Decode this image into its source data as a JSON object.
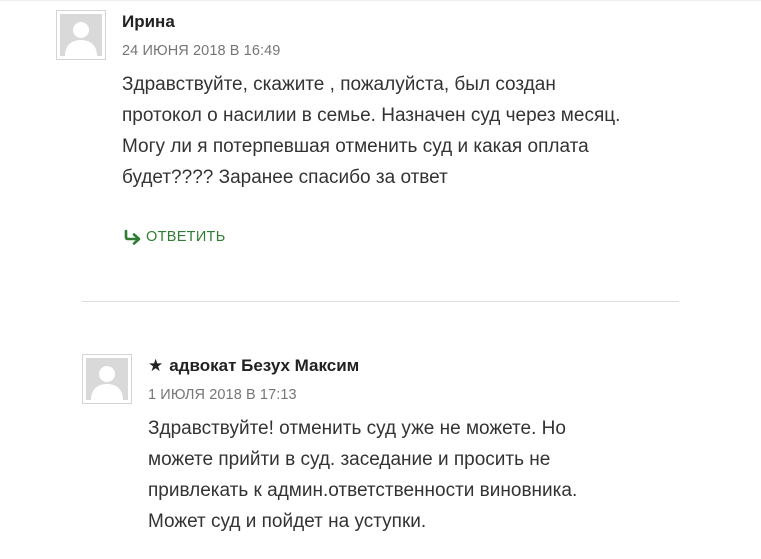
{
  "comments": [
    {
      "author": "Ирина",
      "date": "24 ИЮНЯ 2018 В 16:49",
      "lines": [
        "Здравствуйте, скажите , пожалуйста, был создан",
        "протокол о насилии в семье. Назначен суд через месяц.",
        "Могу ли я потерпевшая отменить суд и какая оплата",
        "будет???? Заранее спасибо за ответ"
      ],
      "reply_label": "ОТВЕТИТЬ"
    },
    {
      "star": "★",
      "author": "адвокат Безух Максим",
      "date": "1 ИЮЛЯ 2018 В 17:13",
      "lines": [
        "Здравствуйте! отменить суд уже не можете. Но",
        "можете прийти в суд. заседание и просить не",
        "привлекать к админ.ответственности виновника.",
        "Может суд и пойдет на уступки."
      ]
    }
  ],
  "colors": {
    "link": "#2e7d32",
    "text": "#333333",
    "meta": "#767676"
  },
  "icons": {
    "avatar": "default-avatar-icon",
    "reply": "reply-arrow-icon",
    "star": "star-icon"
  }
}
